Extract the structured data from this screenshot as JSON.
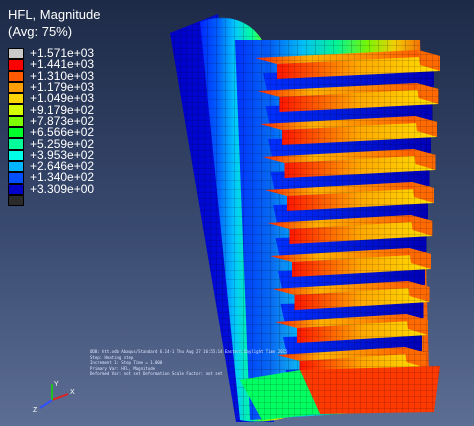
{
  "legend": {
    "title": "HFL, Magnitude",
    "subtitle": "(Avg: 75%)",
    "entries": [
      {
        "value": "+1.571e+03",
        "color": "#c9c9c9"
      },
      {
        "value": "+1.441e+03",
        "color": "#ff0000"
      },
      {
        "value": "+1.310e+03",
        "color": "#ff5a00"
      },
      {
        "value": "+1.179e+03",
        "color": "#ffa000"
      },
      {
        "value": "+1.049e+03",
        "color": "#ffd600"
      },
      {
        "value": "+9.179e+02",
        "color": "#d6ff00"
      },
      {
        "value": "+7.873e+02",
        "color": "#7dff00"
      },
      {
        "value": "+6.566e+02",
        "color": "#00ff2a"
      },
      {
        "value": "+5.259e+02",
        "color": "#00ff9a"
      },
      {
        "value": "+3.953e+02",
        "color": "#00ffe6"
      },
      {
        "value": "+2.646e+02",
        "color": "#00b4ff"
      },
      {
        "value": "+1.340e+02",
        "color": "#0050ff"
      },
      {
        "value": "+3.309e+00",
        "color": "#0000c8"
      }
    ],
    "last_swatch_color": "#2a2a2a"
  },
  "status": {
    "line1": "ODB: htt.odb    Abaqus/Standard 6.14-1    Thu Aug 27 16:55:14 Eastern Daylight Time 2015",
    "line2": "Step: Heating step",
    "line3": "Increment    1: Step Time =    1.000",
    "line4": "Primary Var: HFL, Magnitude",
    "line5": "Deformed Var: not set   Deformation Scale Factor: not set"
  },
  "triad": {
    "x_label": "X",
    "y_label": "Y",
    "z_label": "Z"
  },
  "colors": {
    "background_top": "#1d2a47",
    "background_bottom": "#5d6e94",
    "mesh_line": "#000000"
  }
}
